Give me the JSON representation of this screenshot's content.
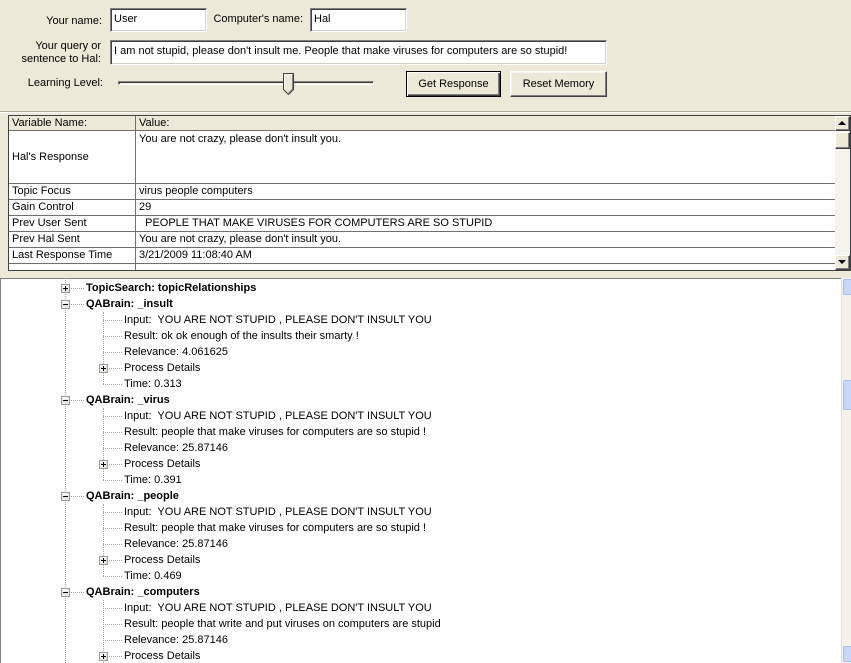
{
  "theme": {
    "window_bg": "#ECE9D8"
  },
  "inputs": {
    "your_name": {
      "label": "Your name:",
      "value": "User"
    },
    "computer_name": {
      "label": "Computer's name:",
      "value": "Hal"
    },
    "query": {
      "label_line1": "Your query or",
      "label_line2": "sentence to Hal:",
      "value": "I am not stupid, please don't insult me. People that make viruses for computers are so stupid!"
    },
    "learning_level": {
      "label": "Learning Level:",
      "level_fraction": 0.67
    }
  },
  "buttons": {
    "get_response": "Get Response",
    "reset_memory": "Reset Memory"
  },
  "variables_grid": {
    "columns": {
      "name": "Variable Name:",
      "value": "Value:"
    },
    "rows": [
      {
        "name": "Hal's Response",
        "value": "You are not crazy, please don't insult you."
      },
      {
        "name": "Topic Focus",
        "value": "virus people computers"
      },
      {
        "name": "Gain Control",
        "value": "29"
      },
      {
        "name": "Prev User Sent",
        "value": "  PEOPLE THAT MAKE VIRUSES FOR COMPUTERS ARE SO STUPID"
      },
      {
        "name": "Prev Hal Sent",
        "value": "You are not crazy, please don't insult you."
      },
      {
        "name": "Last Response Time",
        "value": "3/21/2009 11:08:40 AM"
      },
      {
        "name": "",
        "value": ""
      }
    ]
  },
  "process_tree": {
    "nodes": [
      {
        "label": "TopicSearch: topicRelationships",
        "state": "collapsed"
      },
      {
        "label": "QABrain: _insult",
        "state": "expanded",
        "children": [
          {
            "label": "Input:  YOU ARE NOT STUPID , PLEASE DON'T INSULT YOU"
          },
          {
            "label": "Result: ok ok enough of the insults their smarty !"
          },
          {
            "label": "Relevance: 4.061625"
          },
          {
            "label": "Process Details",
            "state": "collapsed"
          },
          {
            "label": "Time: 0.313"
          }
        ]
      },
      {
        "label": "QABrain: _virus",
        "state": "expanded",
        "children": [
          {
            "label": "Input:  YOU ARE NOT STUPID , PLEASE DON'T INSULT YOU"
          },
          {
            "label": "Result: people that make viruses for computers are so stupid !"
          },
          {
            "label": "Relevance: 25.87146"
          },
          {
            "label": "Process Details",
            "state": "collapsed"
          },
          {
            "label": "Time: 0.391"
          }
        ]
      },
      {
        "label": "QABrain: _people",
        "state": "expanded",
        "children": [
          {
            "label": "Input:  YOU ARE NOT STUPID , PLEASE DON'T INSULT YOU"
          },
          {
            "label": "Result: people that make viruses for computers are so stupid !"
          },
          {
            "label": "Relevance: 25.87146"
          },
          {
            "label": "Process Details",
            "state": "collapsed"
          },
          {
            "label": "Time: 0.469"
          }
        ]
      },
      {
        "label": "QABrain: _computers",
        "state": "expanded",
        "children": [
          {
            "label": "Input:  YOU ARE NOT STUPID , PLEASE DON'T INSULT YOU"
          },
          {
            "label": "Result: people that write and put viruses on computers are stupid"
          },
          {
            "label": "Relevance: 25.87146"
          },
          {
            "label": "Process Details",
            "state": "collapsed"
          }
        ]
      }
    ]
  }
}
